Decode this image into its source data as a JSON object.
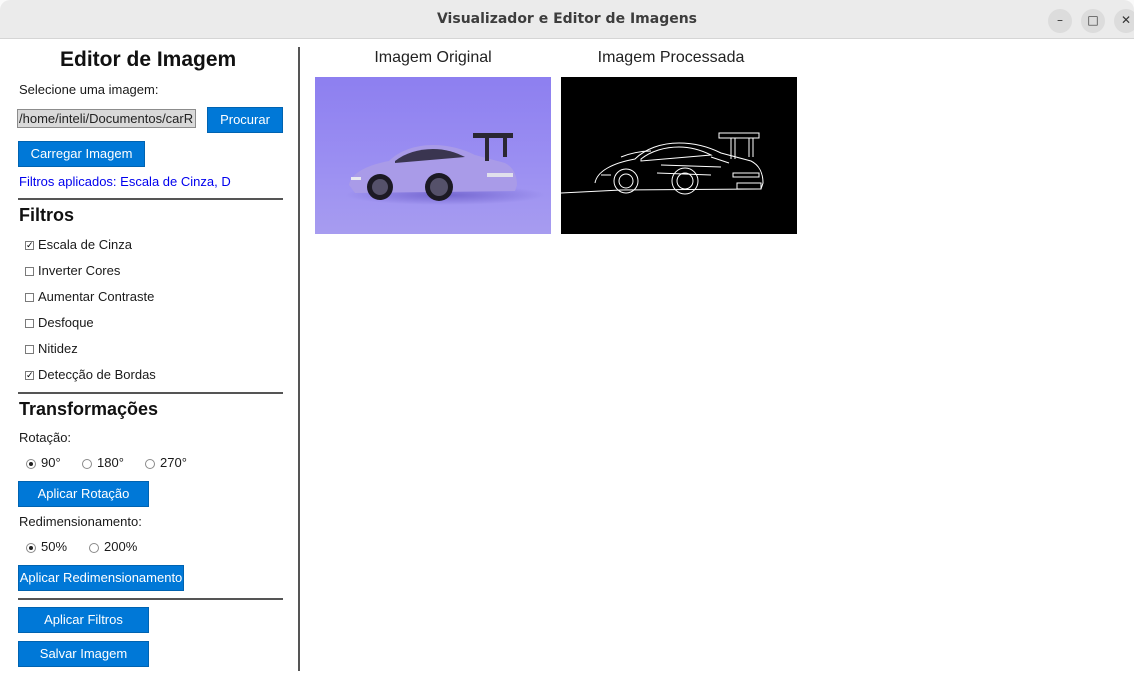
{
  "window": {
    "title": "Visualizador e Editor de Imagens"
  },
  "sidebar": {
    "heading": "Editor de Imagem",
    "select_label": "Selecione uma imagem:",
    "path_value": "/home/inteli/Documentos/carR",
    "browse_button": "Procurar",
    "load_button": "Carregar Imagem",
    "applied_filters": "Filtros aplicados: Escala de Cinza, D",
    "filters": {
      "heading": "Filtros",
      "items": [
        {
          "label": "Escala de Cinza",
          "checked": true
        },
        {
          "label": "Inverter Cores",
          "checked": false
        },
        {
          "label": "Aumentar Contraste",
          "checked": false
        },
        {
          "label": "Desfoque",
          "checked": false
        },
        {
          "label": "Nitidez",
          "checked": false
        },
        {
          "label": "Detecção de Bordas",
          "checked": true
        }
      ]
    },
    "transforms": {
      "heading": "Transformações",
      "rotation_label": "Rotação:",
      "rotation_options": [
        {
          "label": "90°",
          "selected": true
        },
        {
          "label": "180°",
          "selected": false
        },
        {
          "label": "270°",
          "selected": false
        }
      ],
      "apply_rotation": "Aplicar Rotação",
      "resize_label": "Redimensionamento:",
      "resize_options": [
        {
          "label": "50%",
          "selected": true
        },
        {
          "label": "200%",
          "selected": false
        }
      ],
      "apply_resize": "Aplicar Redimensionamento"
    },
    "apply_filters": "Aplicar Filtros",
    "save_image": "Salvar Imagem"
  },
  "preview": {
    "original_title": "Imagem Original",
    "processed_title": "Imagem Processada"
  },
  "colors": {
    "accent": "#0078d7",
    "applied_text": "#0000ee"
  }
}
